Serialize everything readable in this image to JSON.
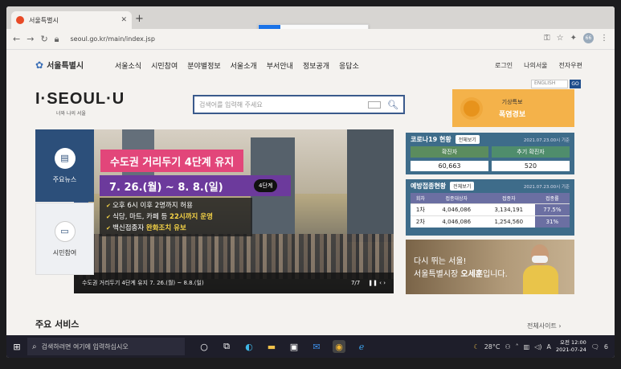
{
  "browser": {
    "tab_title": "서울특별시",
    "url": "seoul.go.kr/main/index.jsp",
    "avatar_initials": "66"
  },
  "site": {
    "logo_small": "서울특별시",
    "menu": [
      "서울소식",
      "시민참여",
      "분야별정보",
      "서울소개",
      "부서안내",
      "정보공개",
      "응답소"
    ],
    "util": [
      "로그인",
      "나의서울",
      "전자우편"
    ],
    "lang_select": "ENGLISH",
    "lang_go": "GO",
    "big_logo": "I·SEOUL·U",
    "slogan": "너와 나의 서울",
    "search_placeholder": "검색어를 입력해 주세요",
    "weather": {
      "title": "기상특보",
      "status": "폭염경보"
    }
  },
  "quick_menu": [
    {
      "label": "주요뉴스",
      "icon": "news-icon"
    },
    {
      "label": "시민참여",
      "icon": "monitor-icon"
    }
  ],
  "banner": {
    "tile_text": "요",
    "title": "수도권 거리두기 4단계 유지",
    "dates": "7. 26.(월) ~ 8. 8.(일)",
    "badge": "4단계",
    "bullets": [
      {
        "pre": "오후 6시 이후 2명까지 허용",
        "hl": "",
        "post": ""
      },
      {
        "pre": "식당, 마트, 카페 등 ",
        "hl": "22시까지 운영",
        "post": ""
      },
      {
        "pre": "백신접종자 ",
        "hl": "완화조치 유보",
        "post": ""
      }
    ],
    "caption": "수도권 거리두기 4단계 유지 7. 26.(월) ~ 8.8.(일)",
    "page": "7/7",
    "controls": "❚❚ ‹ ›"
  },
  "covid": {
    "title": "코로나19 현황",
    "btn": "전체보기",
    "stamp": "2021.07.23.00시 기준",
    "labels": [
      "확진자",
      "추기 확진자"
    ],
    "values": [
      "60,663",
      "520"
    ]
  },
  "vaccine": {
    "title": "예방접종현황",
    "btn": "전체보기",
    "stamp": "2021.07.23.00시 기준",
    "headers": [
      "회차",
      "접종대상자",
      "접종자",
      "접종률"
    ],
    "rows": [
      [
        "1차",
        "4,046,086",
        "3,134,191",
        "77.5%"
      ],
      [
        "2차",
        "4,046,086",
        "1,254,560",
        "31%"
      ]
    ]
  },
  "mayor": {
    "line1": "다시 뛰는 서울!",
    "line2_pre": "서울특별시장 ",
    "line2_name": "오세훈",
    "line2_post": "입니다."
  },
  "services_title": "주요 서비스",
  "sitemap": "전체사이트 ›",
  "taskbar": {
    "search": "검색하려면 여기에 입력하십시오",
    "temp": "28°C",
    "ime": "A",
    "time": "오전 12:00",
    "date": "2021-07-24",
    "notif": "6"
  }
}
